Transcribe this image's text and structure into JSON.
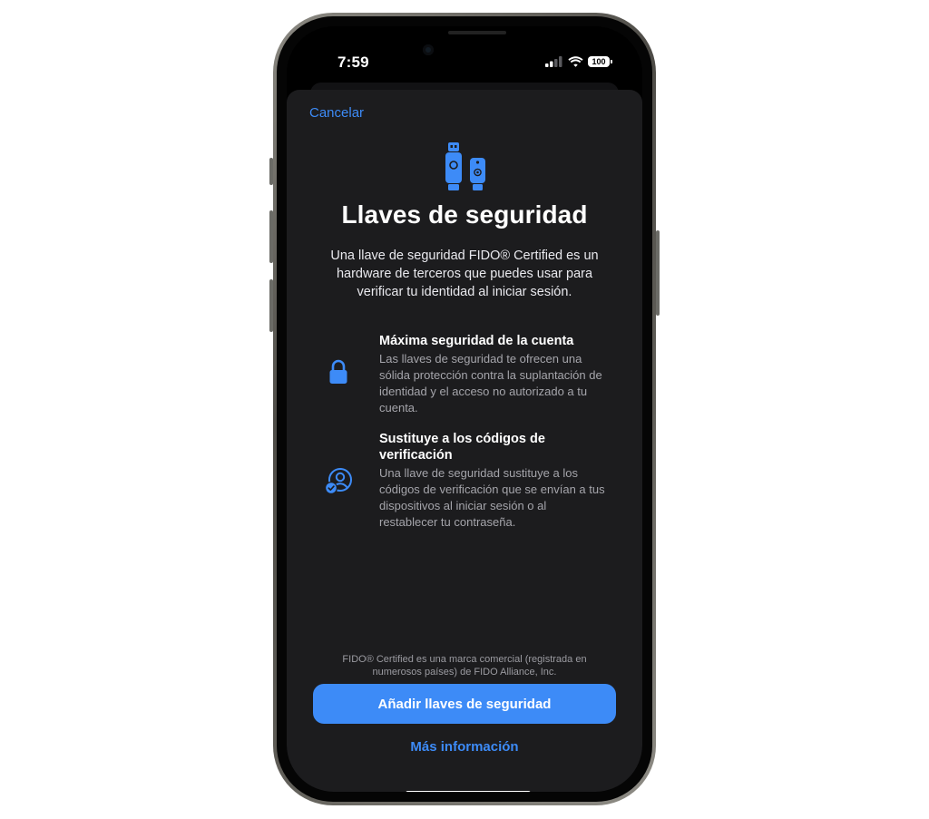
{
  "status_bar": {
    "time": "7:59",
    "battery": "100"
  },
  "sheet": {
    "cancel_label": "Cancelar",
    "title": "Llaves de seguridad",
    "intro": "Una llave de seguridad FIDO® Certified es un hardware de terceros que puedes usar para verificar tu identidad al iniciar sesión.",
    "features": [
      {
        "icon": "lock-icon",
        "title": "Máxima seguridad de la cuenta",
        "body": "Las llaves de seguridad te ofrecen una sólida protección contra la suplantación de identidad y el acceso no autorizado a tu cuenta."
      },
      {
        "icon": "person-verified-icon",
        "title": "Sustituye a los códigos de verificación",
        "body": "Una llave de seguridad sustituye a los códigos de verificación que se envían a tus dispositivos al iniciar sesión o al restablecer tu contraseña."
      }
    ],
    "footnote": "FIDO® Certified es una marca comercial (registrada en numerosos países) de FIDO Alliance, Inc.",
    "primary_button": "Añadir llaves de seguridad",
    "secondary_link": "Más información"
  },
  "colors": {
    "accent": "#3d8bf7",
    "sheet_background": "#1c1c1e",
    "primary_text": "#ffffff",
    "secondary_text": "#a5a5ab"
  },
  "icons": {
    "hero": "security-keys-icon",
    "signal": "cellular-signal-icon",
    "wifi": "wifi-icon",
    "battery": "battery-icon"
  }
}
